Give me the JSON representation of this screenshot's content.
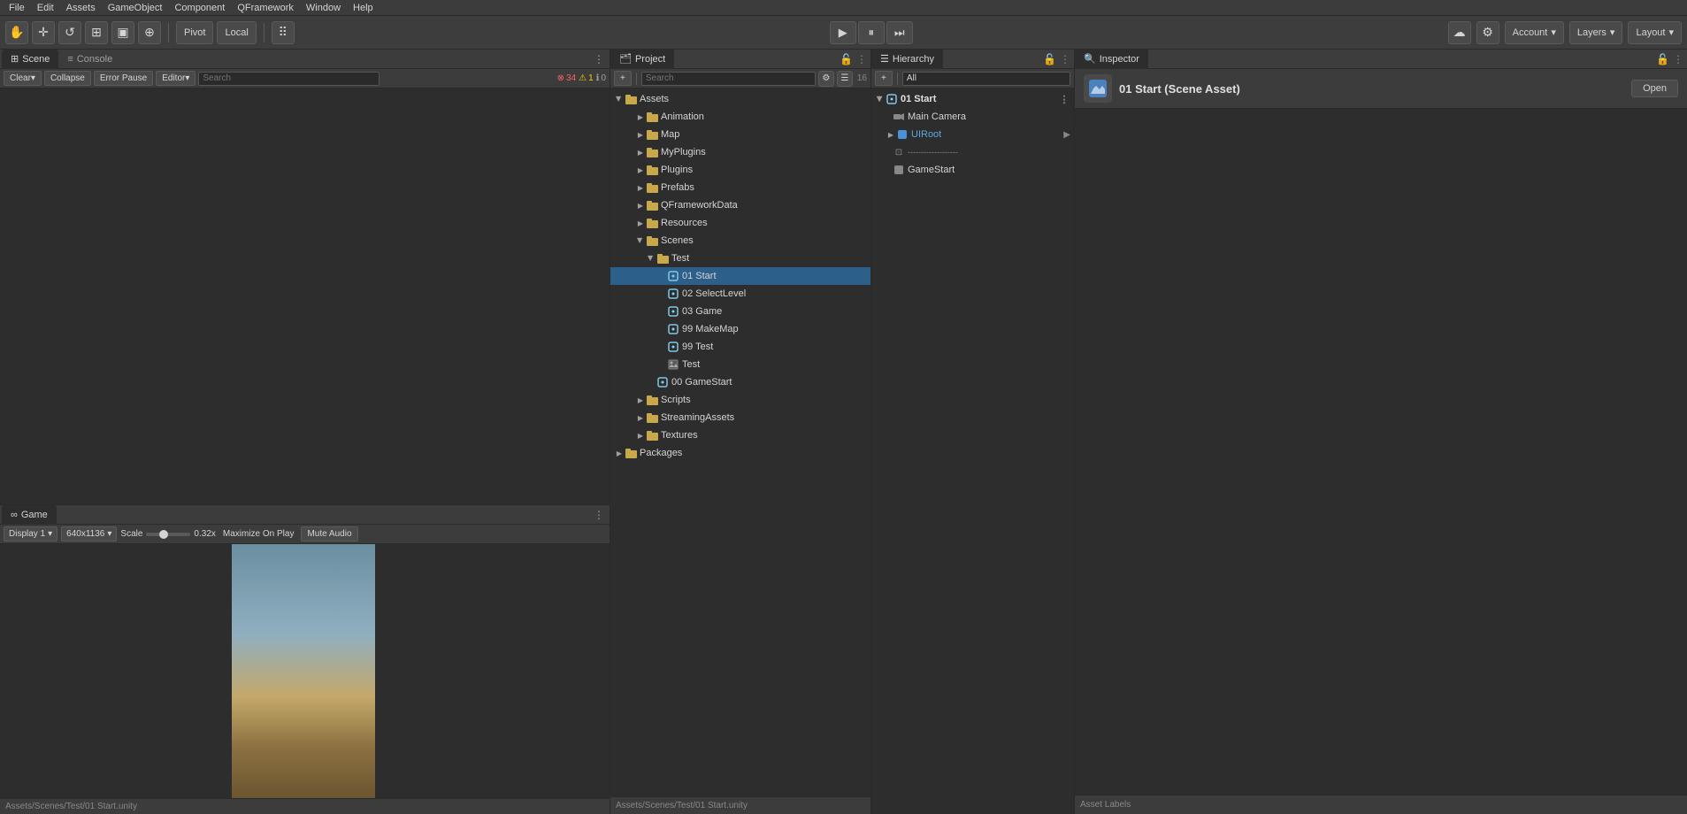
{
  "menubar": {
    "items": [
      "File",
      "Edit",
      "Assets",
      "GameObject",
      "Component",
      "QFramework",
      "Window",
      "Help"
    ]
  },
  "toolbar": {
    "hand_label": "✋",
    "move_label": "✛",
    "rotate_label": "↺",
    "scale_label": "⊞",
    "rect_label": "⊡",
    "transform_label": "⊕",
    "pivot_label": "Pivot",
    "local_label": "Local",
    "collab_icon": "☁",
    "account_label": "Account",
    "layers_label": "Layers",
    "layout_label": "Layout"
  },
  "scene_panel": {
    "tab_scene": "Scene",
    "tab_console": "Console",
    "clear_btn": "Clear",
    "collapse_btn": "Collapse",
    "error_pause_btn": "Error Pause",
    "editor_btn": "Editor",
    "badge_error": "34",
    "badge_warn": "1",
    "badge_info": "0"
  },
  "game_panel": {
    "tab_game": "Game",
    "display_label": "Display 1",
    "resolution_label": "640x1136",
    "scale_label": "Scale",
    "scale_value": "0.32x",
    "maximize_label": "Maximize On Play",
    "mute_label": "Mute Audio"
  },
  "status_bar": {
    "text": "Assets/Scenes/Test/01 Start.unity"
  },
  "project_panel": {
    "tab_label": "Project",
    "search_placeholder": "Search",
    "items_count": "16",
    "tree": [
      {
        "id": "assets",
        "label": "Assets",
        "level": 0,
        "expanded": true,
        "type": "folder"
      },
      {
        "id": "animation",
        "label": "Animation",
        "level": 1,
        "expanded": false,
        "type": "folder"
      },
      {
        "id": "map",
        "label": "Map",
        "level": 1,
        "expanded": false,
        "type": "folder"
      },
      {
        "id": "myplugins",
        "label": "MyPlugins",
        "level": 1,
        "expanded": false,
        "type": "folder"
      },
      {
        "id": "plugins",
        "label": "Plugins",
        "level": 1,
        "expanded": false,
        "type": "folder"
      },
      {
        "id": "prefabs",
        "label": "Prefabs",
        "level": 1,
        "expanded": false,
        "type": "folder"
      },
      {
        "id": "qframeworkdata",
        "label": "QFrameworkData",
        "level": 1,
        "expanded": false,
        "type": "folder"
      },
      {
        "id": "resources",
        "label": "Resources",
        "level": 1,
        "expanded": false,
        "type": "folder"
      },
      {
        "id": "scenes",
        "label": "Scenes",
        "level": 1,
        "expanded": true,
        "type": "folder"
      },
      {
        "id": "test",
        "label": "Test",
        "level": 2,
        "expanded": true,
        "type": "folder"
      },
      {
        "id": "01start",
        "label": "01 Start",
        "level": 3,
        "expanded": false,
        "type": "scene",
        "selected": true
      },
      {
        "id": "02selectlevel",
        "label": "02 SelectLevel",
        "level": 3,
        "expanded": false,
        "type": "scene"
      },
      {
        "id": "03game",
        "label": "03 Game",
        "level": 3,
        "expanded": false,
        "type": "scene"
      },
      {
        "id": "99makemap",
        "label": "99 MakeMap",
        "level": 3,
        "expanded": false,
        "type": "scene"
      },
      {
        "id": "99test",
        "label": "99 Test",
        "level": 3,
        "expanded": false,
        "type": "scene"
      },
      {
        "id": "test2",
        "label": "Test",
        "level": 3,
        "expanded": false,
        "type": "image"
      },
      {
        "id": "00gamestart",
        "label": "00 GameStart",
        "level": 2,
        "expanded": false,
        "type": "scene"
      },
      {
        "id": "scripts",
        "label": "Scripts",
        "level": 1,
        "expanded": false,
        "type": "folder"
      },
      {
        "id": "streamingassets",
        "label": "StreamingAssets",
        "level": 1,
        "expanded": false,
        "type": "folder"
      },
      {
        "id": "textures",
        "label": "Textures",
        "level": 1,
        "expanded": false,
        "type": "folder"
      },
      {
        "id": "packages",
        "label": "Packages",
        "level": 0,
        "expanded": false,
        "type": "folder"
      }
    ]
  },
  "hierarchy_panel": {
    "tab_label": "Hierarchy",
    "search_placeholder": "All",
    "items": [
      {
        "id": "scene01start",
        "label": "01 Start",
        "level": 0,
        "type": "scene",
        "expanded": true
      },
      {
        "id": "maincamera",
        "label": "Main Camera",
        "level": 1,
        "type": "camera"
      },
      {
        "id": "uiroot",
        "label": "UIRoot",
        "level": 1,
        "type": "object_blue",
        "has_arrow": true
      },
      {
        "id": "dashed",
        "label": "-------------------",
        "level": 1,
        "type": "dashed"
      },
      {
        "id": "gamestart",
        "label": "GameStart",
        "level": 1,
        "type": "object"
      }
    ]
  },
  "inspector_panel": {
    "tab_label": "Inspector",
    "title": "01 Start (Scene Asset)",
    "open_btn": "Open",
    "asset_labels": "Asset Labels"
  }
}
